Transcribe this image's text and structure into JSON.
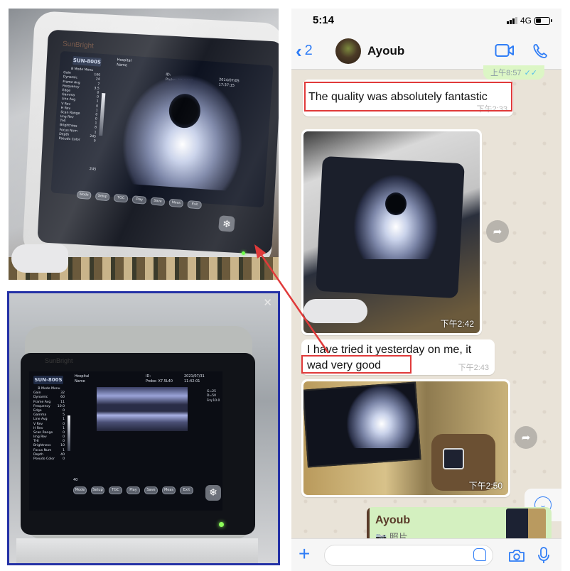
{
  "photo_top": {
    "device_brand": "SunBright",
    "model": "SUN-800S",
    "header": {
      "hospital": "Hospital",
      "name": "Name",
      "id": "ID:",
      "probe": "Probe: X3.5C60",
      "date": "2014/07/05",
      "time": "17:37:15"
    },
    "menu_title": "B Mode Menu",
    "menu": [
      {
        "label": "Gain",
        "value": "100"
      },
      {
        "label": "Dynamic",
        "value": "24"
      },
      {
        "label": "Frame Avg",
        "value": "7"
      },
      {
        "label": "Frequency",
        "value": "3.5"
      },
      {
        "label": "Edge",
        "value": "0"
      },
      {
        "label": "Gamma",
        "value": "0"
      },
      {
        "label": "Line Avg",
        "value": "1"
      },
      {
        "label": "V Rev",
        "value": "0"
      },
      {
        "label": "H Rev",
        "value": "1"
      },
      {
        "label": "Scan Range",
        "value": "0"
      },
      {
        "label": "Img Rev",
        "value": "0"
      },
      {
        "label": "THI",
        "value": "1"
      },
      {
        "label": "Brightness",
        "value": "8"
      },
      {
        "label": "Focus Num",
        "value": "1"
      },
      {
        "label": "Depth",
        "value": "245"
      },
      {
        "label": "Pseudo Color",
        "value": "0"
      }
    ],
    "depth_readout": "245",
    "buttons": [
      "Mode",
      "Setup",
      "TGC",
      "Play",
      "Save",
      "Meas",
      "Exit"
    ]
  },
  "photo_bottom": {
    "device_brand": "SunBright",
    "model": "SUN-800S",
    "header": {
      "hospital": "Hospital",
      "name": "Name",
      "id": "ID:",
      "probe": "Probe: X7.5L40",
      "date": "2021/07/31",
      "time": "11:42:01"
    },
    "side_readout": [
      "G=25",
      "D=50",
      "Frq:10.0"
    ],
    "menu_title": "B Mode Menu",
    "menu": [
      {
        "label": "Gain",
        "value": "32"
      },
      {
        "label": "Dynamic",
        "value": "60"
      },
      {
        "label": "Frame Avg",
        "value": "11"
      },
      {
        "label": "Frequency",
        "value": "10.0"
      },
      {
        "label": "Edge",
        "value": "0"
      },
      {
        "label": "Gamma",
        "value": "5"
      },
      {
        "label": "Line Avg",
        "value": "1"
      },
      {
        "label": "V Rev",
        "value": "0"
      },
      {
        "label": "H Rev",
        "value": "1"
      },
      {
        "label": "Scan Range",
        "value": "0"
      },
      {
        "label": "Img Rev",
        "value": "0"
      },
      {
        "label": "THI",
        "value": "0"
      },
      {
        "label": "Brightness",
        "value": "10"
      },
      {
        "label": "Focus Num",
        "value": "1"
      },
      {
        "label": "Depth",
        "value": "40"
      },
      {
        "label": "Pseudo Color",
        "value": "0"
      }
    ],
    "depth_readout": "40",
    "buttons": [
      "Mode",
      "Setup",
      "TGC",
      "Play",
      "Save",
      "Meas",
      "Exit"
    ],
    "close_glyph": "✕"
  },
  "phone": {
    "status": {
      "time": "5:14",
      "network": "4G"
    },
    "nav": {
      "back_count": "2",
      "contact": "Ayoub"
    },
    "outgoing_peek": {
      "time": "上午8:57",
      "ticks": "✓✓"
    },
    "messages": [
      {
        "type": "text",
        "text": "The quality was absolutely fantastic",
        "time": "下午2:33"
      },
      {
        "type": "image",
        "time": "下午2:42"
      },
      {
        "type": "text",
        "text_line1": "I have tried it yesterday on me, it",
        "text_line2": "wad very good",
        "time": "下午2:43"
      },
      {
        "type": "image",
        "time": "下午2:50"
      }
    ],
    "reply_card": {
      "name": "Ayoub",
      "subtitle": "📷 照片"
    },
    "composer": {
      "placeholder": ""
    }
  },
  "colors": {
    "highlight_red": "#e03a3a",
    "ios_blue": "#2f7df6",
    "frame_blue": "#2431a6",
    "outgoing_green": "#dcf6c5"
  }
}
